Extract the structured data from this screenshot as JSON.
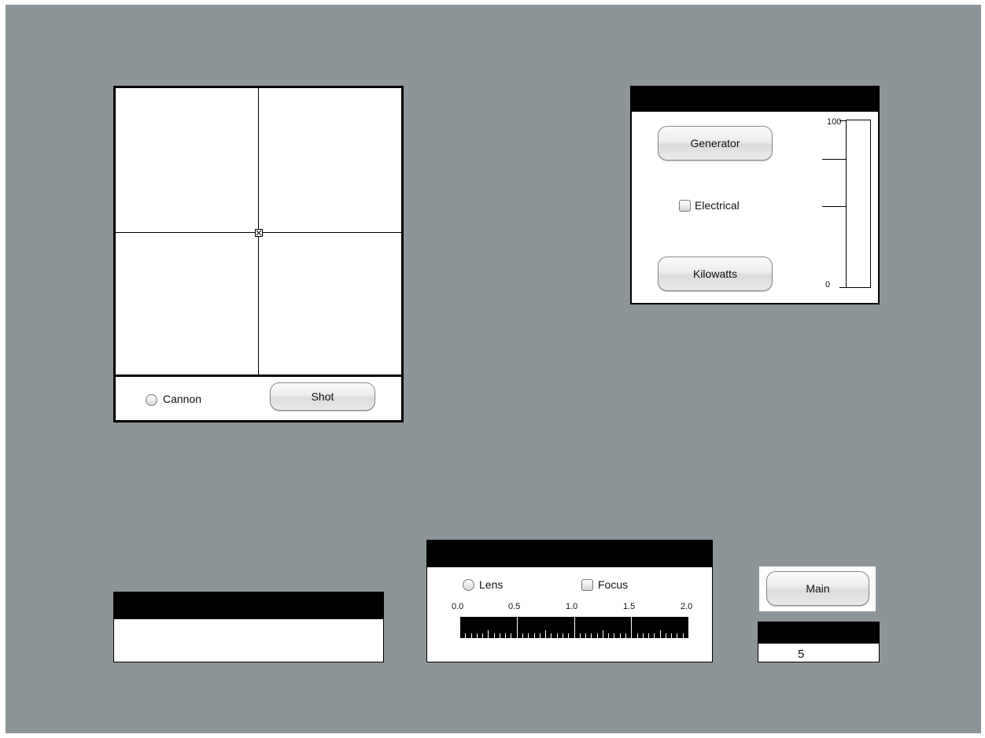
{
  "crosshair_panel": {
    "radio_label": "Cannon",
    "button_label": "Shot"
  },
  "generator_panel": {
    "generator_label": "Generator",
    "checkbox_label": "Electrical",
    "kilowatts_label": "Kilowatts",
    "gauge_max": "100",
    "gauge_min": "0",
    "gauge_level": 0
  },
  "lens_panel": {
    "radio_label": "Lens",
    "checkbox_label": "Focus",
    "scale_ticks": [
      "0.0",
      "0.5",
      "1.0",
      "1.5",
      "2.0"
    ]
  },
  "main_panel": {
    "button_label": "Main"
  },
  "counter_panel": {
    "value": "5"
  }
}
